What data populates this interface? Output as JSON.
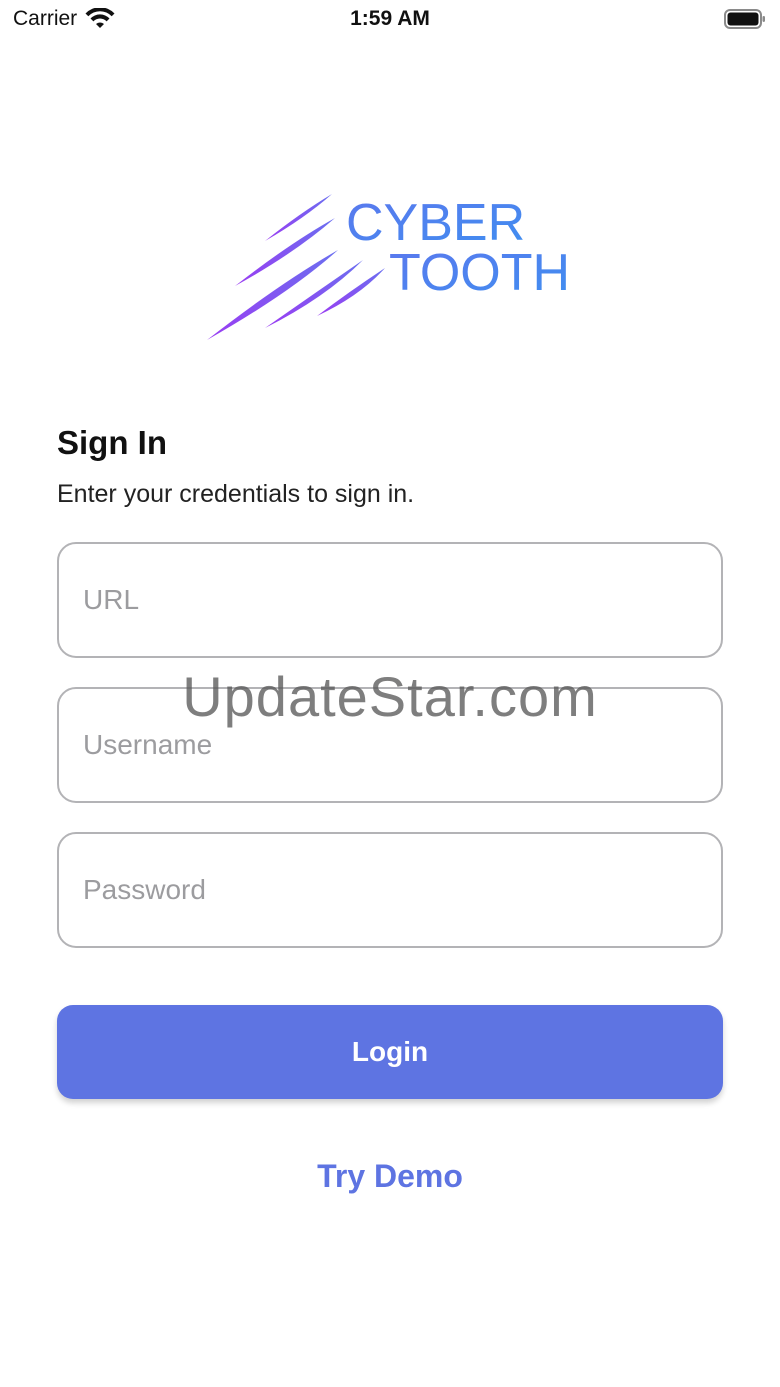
{
  "status_bar": {
    "carrier": "Carrier",
    "time": "1:59 AM",
    "wifi_icon": "wifi-icon",
    "battery_icon": "battery-icon"
  },
  "logo": {
    "line1": "CYBER",
    "line2": "TOOTH",
    "mark_icon": "claw-marks-icon",
    "colors": {
      "gradient_start": "#8a3ff0",
      "gradient_end": "#4a8cf2"
    }
  },
  "signin": {
    "title": "Sign In",
    "subtitle": "Enter your credentials to sign in."
  },
  "form": {
    "url": {
      "placeholder": "URL",
      "value": ""
    },
    "username": {
      "placeholder": "Username",
      "value": ""
    },
    "password": {
      "placeholder": "Password",
      "value": ""
    }
  },
  "actions": {
    "login_label": "Login",
    "demo_label": "Try Demo"
  },
  "watermark": "UpdateStar.com",
  "colors": {
    "accent": "#5e74e2",
    "field_border": "#b3b3b6",
    "placeholder": "#9c9c9f"
  }
}
